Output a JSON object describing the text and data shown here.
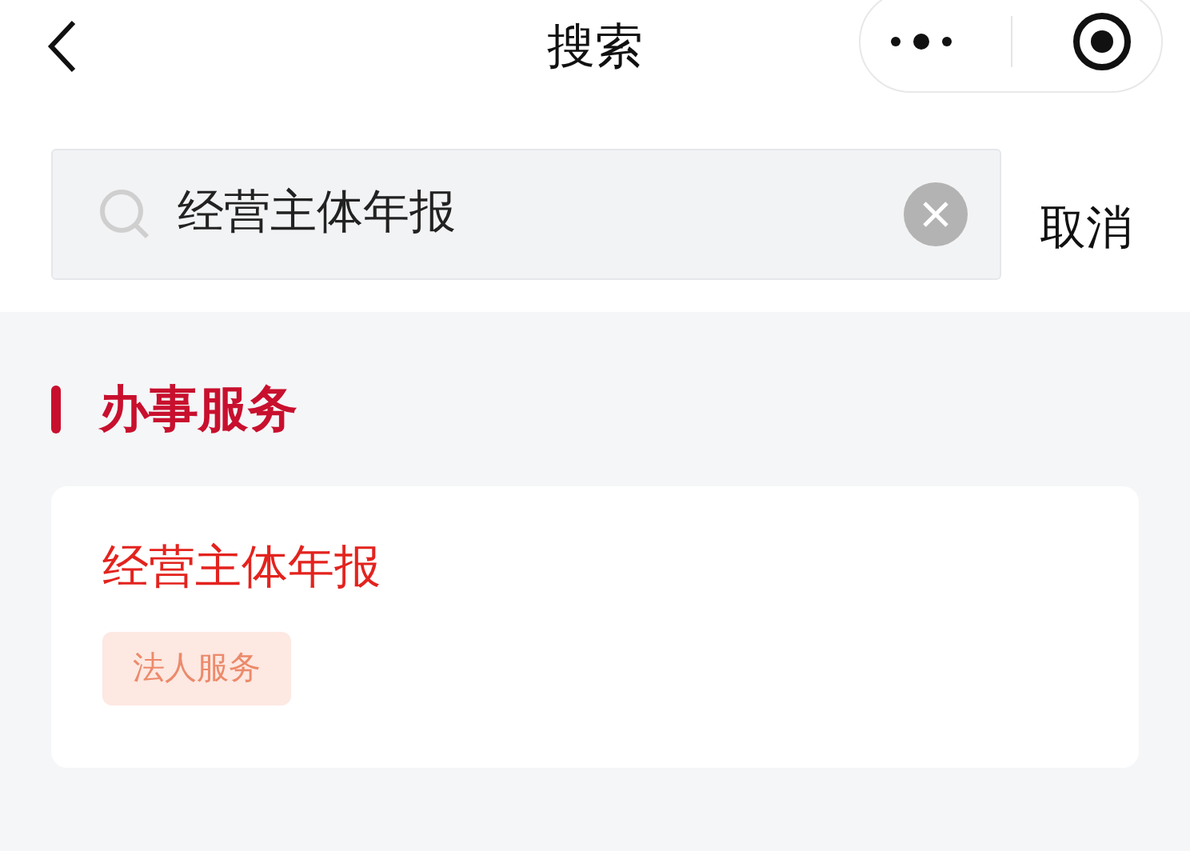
{
  "header": {
    "title": "搜索"
  },
  "search": {
    "value": "经营主体年报",
    "cancel": "取消"
  },
  "section": {
    "title": "办事服务",
    "items": [
      {
        "title": "经营主体年报",
        "tag": "法人服务"
      }
    ]
  }
}
